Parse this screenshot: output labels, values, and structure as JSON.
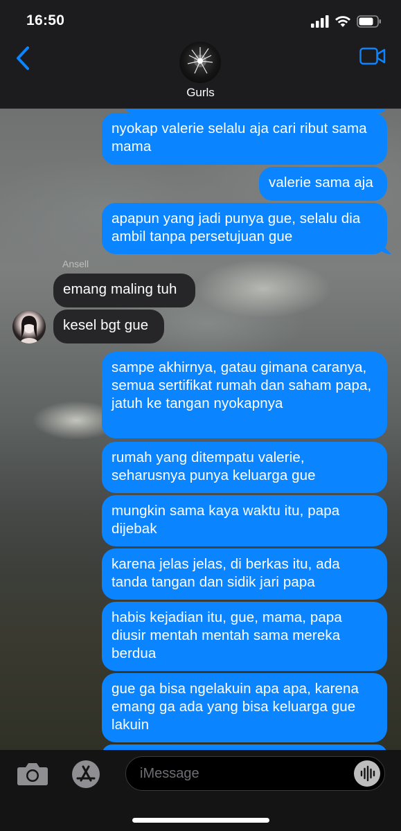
{
  "status_bar": {
    "time": "16:50"
  },
  "header": {
    "group_name": "Gurls"
  },
  "messages": [
    {
      "text": "nyokap valerie selalu aja cari ribut sama mama"
    },
    {
      "text": "valerie sama aja"
    },
    {
      "text": "apapun yang jadi punya gue, selalu dia ambil tanpa persetujuan gue"
    },
    {
      "sender": "Ansell",
      "text": "emang maling tuh"
    },
    {
      "text": "kesel bgt gue"
    },
    {
      "text": "sampe akhirnya, gatau gimana caranya, semua sertifikat rumah dan saham papa, jatuh ke tangan nyokapnya"
    },
    {
      "text": "rumah yang ditempatu valerie, seharusnya punya keluarga gue"
    },
    {
      "text": "mungkin sama kaya waktu itu, papa dijebak"
    },
    {
      "text": "karena jelas jelas, di berkas itu, ada tanda tangan dan sidik jari papa"
    },
    {
      "text": "habis kejadian itu, gue, mama, papa diusir mentah mentah sama mereka berdua"
    },
    {
      "text": "gue ga bisa ngelakuin apa apa, karena emang ga ada yang bisa keluarga gue lakuin"
    }
  ],
  "compose": {
    "placeholder": "iMessage"
  },
  "colors": {
    "outgoing_bubble": "#0a84ff",
    "incoming_bubble": "#262628",
    "accent": "#0a84ff"
  },
  "icons": [
    "signal-icon",
    "wifi-icon",
    "battery-icon",
    "back-chevron-icon",
    "video-call-icon",
    "camera-icon",
    "app-store-icon",
    "audio-message-icon"
  ]
}
